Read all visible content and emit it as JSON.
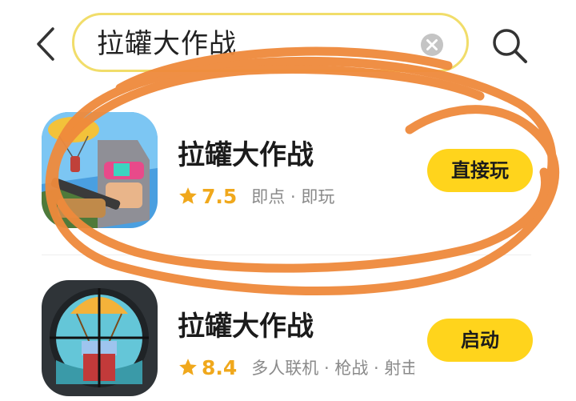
{
  "search": {
    "query": "拉罐大作战"
  },
  "results": [
    {
      "name": "拉罐大作战",
      "rating": "7.5",
      "tags": "即点 · 即玩",
      "action": "直接玩"
    },
    {
      "name": "拉罐大作战",
      "rating": "8.4",
      "tags": "多人联机 · 枪战 · 射击",
      "action": "启动"
    }
  ],
  "colors": {
    "accent_yellow": "#ffd41c",
    "search_border": "#f1dd6a",
    "rating_orange": "#f0a81c",
    "annotation_orange": "#ef8a3c"
  },
  "icons": [
    "back-arrow-icon",
    "clear-icon",
    "search-icon",
    "star-icon"
  ]
}
